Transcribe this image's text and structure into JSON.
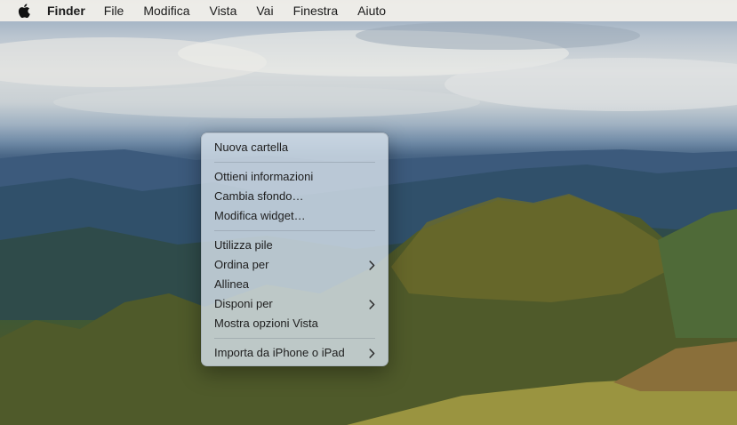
{
  "menubar": {
    "apple_icon": "apple-logo-icon",
    "app_name": "Finder",
    "items": [
      {
        "label": "File"
      },
      {
        "label": "Modifica"
      },
      {
        "label": "Vista"
      },
      {
        "label": "Vai"
      },
      {
        "label": "Finestra"
      },
      {
        "label": "Aiuto"
      }
    ]
  },
  "context_menu": {
    "groups": [
      [
        {
          "label": "Nuova cartella",
          "submenu": false
        }
      ],
      [
        {
          "label": "Ottieni informazioni",
          "submenu": false
        },
        {
          "label": "Cambia sfondo…",
          "submenu": false
        },
        {
          "label": "Modifica widget…",
          "submenu": false
        }
      ],
      [
        {
          "label": "Utilizza pile",
          "submenu": false
        },
        {
          "label": "Ordina per",
          "submenu": true
        },
        {
          "label": "Allinea",
          "submenu": false
        },
        {
          "label": "Disponi per",
          "submenu": true
        },
        {
          "label": "Mostra opzioni Vista",
          "submenu": false
        }
      ],
      [
        {
          "label": "Importa da iPhone o iPad",
          "submenu": true
        }
      ]
    ],
    "chevron_icon": "chevron-right-icon"
  },
  "colors": {
    "menubar_bg": "#f0eee9",
    "menu_bg": "#d6e0ea",
    "text": "#1e1e1e"
  }
}
